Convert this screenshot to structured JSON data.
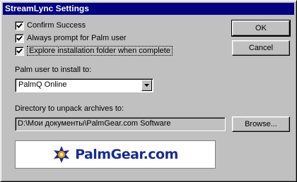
{
  "window": {
    "title": "StreamLync Settings"
  },
  "options": [
    {
      "label": "Confirm Success",
      "checked": true
    },
    {
      "label": "Always prompt for Palm user",
      "checked": true
    },
    {
      "label": "Explore installation folder when complete",
      "checked": true
    }
  ],
  "buttons": {
    "ok": "OK",
    "cancel": "Cancel",
    "browse": "Browse..."
  },
  "palm_user": {
    "label": "Palm user to install to:",
    "value": "PalmQ Online"
  },
  "directory": {
    "label": "Directory to unpack archives to:",
    "value": "D:\\Мои документы\\PalmGear.com Software"
  },
  "banner": {
    "part1": "Palm",
    "part2": "Gear",
    "part3": ".com",
    "icon": "gear-logo-icon"
  },
  "colors": {
    "title_bar": "#000080",
    "face": "#c0c0c0",
    "logo_blue": "#1a2c8c",
    "logo_gear": "#f0a000"
  }
}
